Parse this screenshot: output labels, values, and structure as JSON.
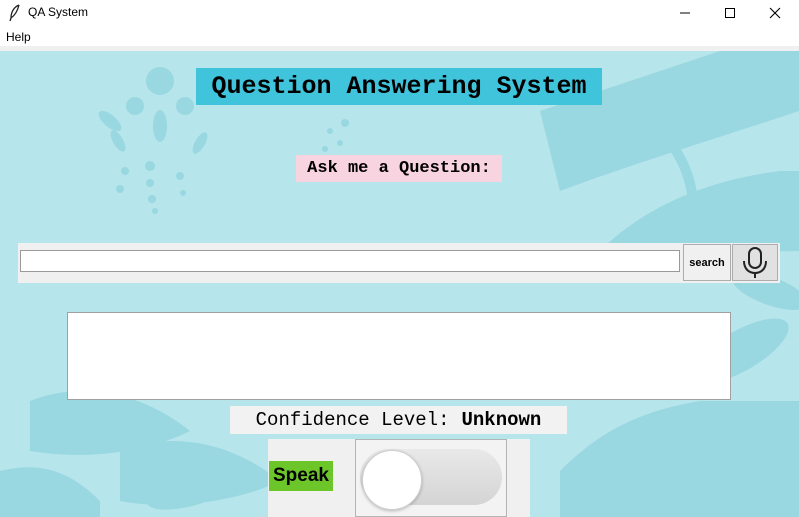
{
  "window": {
    "title": "QA System",
    "app_icon": "feather-icon",
    "controls": [
      "minimize-icon",
      "maximize-icon",
      "close-icon"
    ]
  },
  "menu": {
    "items": [
      {
        "label": "Help"
      }
    ]
  },
  "main": {
    "title": "Question Answering System",
    "prompt": "Ask me a Question:",
    "search": {
      "value": "",
      "placeholder": "",
      "button_label": "search",
      "mic_icon": "microphone-icon"
    },
    "answer": {
      "value": ""
    },
    "confidence": {
      "label": "Confidence Level:",
      "value": "Unknown"
    },
    "speak": {
      "label": "Speak",
      "toggle_state": "off"
    }
  },
  "colors": {
    "background": "#b7e5ec",
    "title_bg": "#3fc4dc",
    "prompt_bg": "#f8d3e0",
    "speak_bg": "#6cc62a"
  }
}
